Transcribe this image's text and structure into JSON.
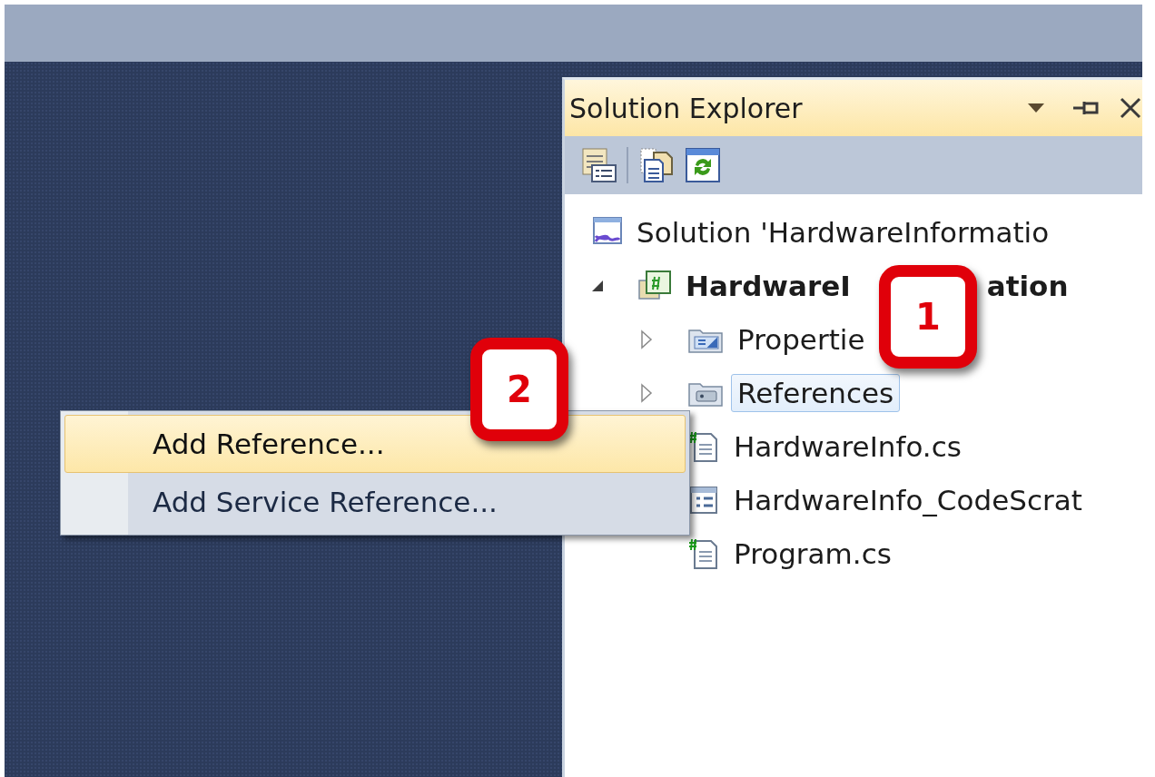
{
  "solution_explorer": {
    "title": "Solution Explorer",
    "tree": [
      {
        "kind": "solution",
        "label_parts": [
          "Solution 'HardwareInformatio"
        ],
        "selected": false,
        "children": [
          {
            "kind": "project",
            "label_parts": [
              "HardwareI",
              "ation"
            ],
            "expanded": true,
            "selected": false,
            "children": [
              {
                "kind": "properties",
                "label_parts": [
                  "Propertie"
                ],
                "expanded": false,
                "selected": false
              },
              {
                "kind": "references",
                "label_parts": [
                  "References"
                ],
                "expanded": false,
                "selected": true
              },
              {
                "kind": "cs",
                "label_parts": [
                  "HardwareInfo.cs"
                ],
                "selected": false
              },
              {
                "kind": "settings",
                "label_parts": [
                  "HardwareInfo_CodeScrat"
                ],
                "selected": false
              },
              {
                "kind": "cs",
                "label_parts": [
                  "Program.cs"
                ],
                "selected": false
              }
            ]
          }
        ]
      }
    ]
  },
  "context_menu": {
    "items": [
      {
        "label": "Add Reference...",
        "selected": true
      },
      {
        "label": "Add Service Reference...",
        "selected": false
      }
    ]
  },
  "callouts": [
    {
      "number": "1"
    },
    {
      "number": "2"
    }
  ]
}
